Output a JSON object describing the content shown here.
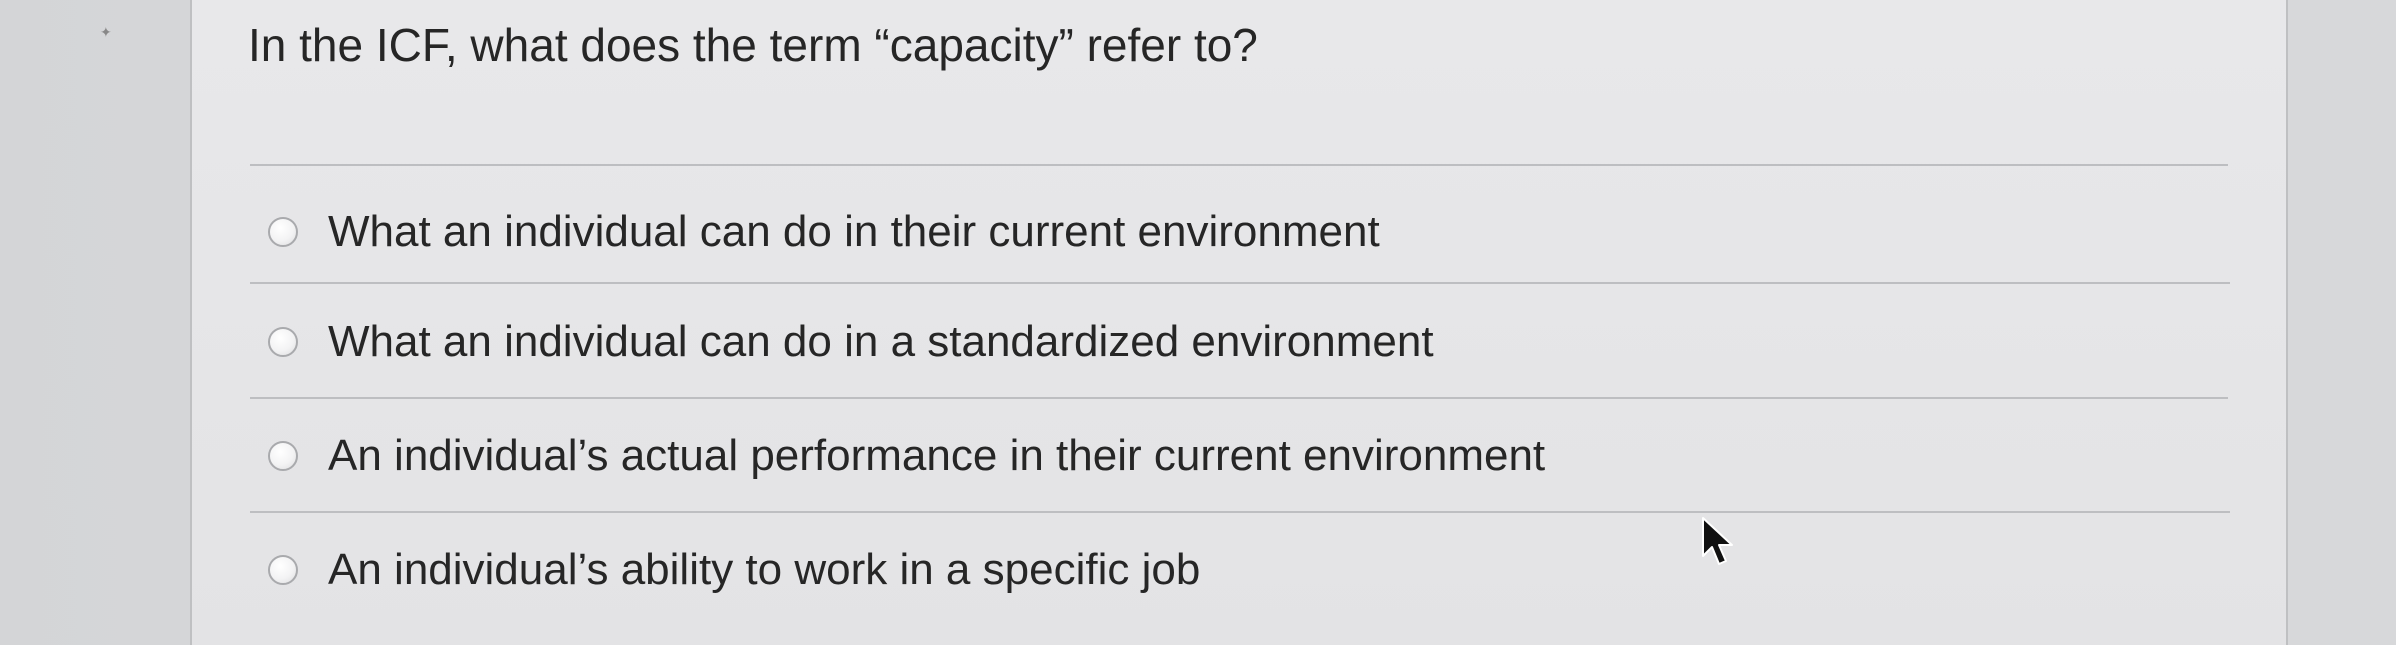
{
  "question": {
    "text": "In the ICF, what does the term “capacity” refer to?"
  },
  "options": [
    {
      "label": "What an individual can do in their current environment",
      "selected": false
    },
    {
      "label": "What an individual can do in a standardized environment",
      "selected": false
    },
    {
      "label": "An individual’s actual performance in their current environment",
      "selected": false
    },
    {
      "label": "An individual’s ability to work in a specific job",
      "selected": false
    }
  ],
  "icons": {
    "radio": "radio-button-unchecked",
    "cursor": "mouse-pointer-arrow"
  },
  "colors": {
    "text": "#262626",
    "rule": "#bdbec1",
    "card": "#e6e6e8",
    "background": "#d8d9db"
  }
}
